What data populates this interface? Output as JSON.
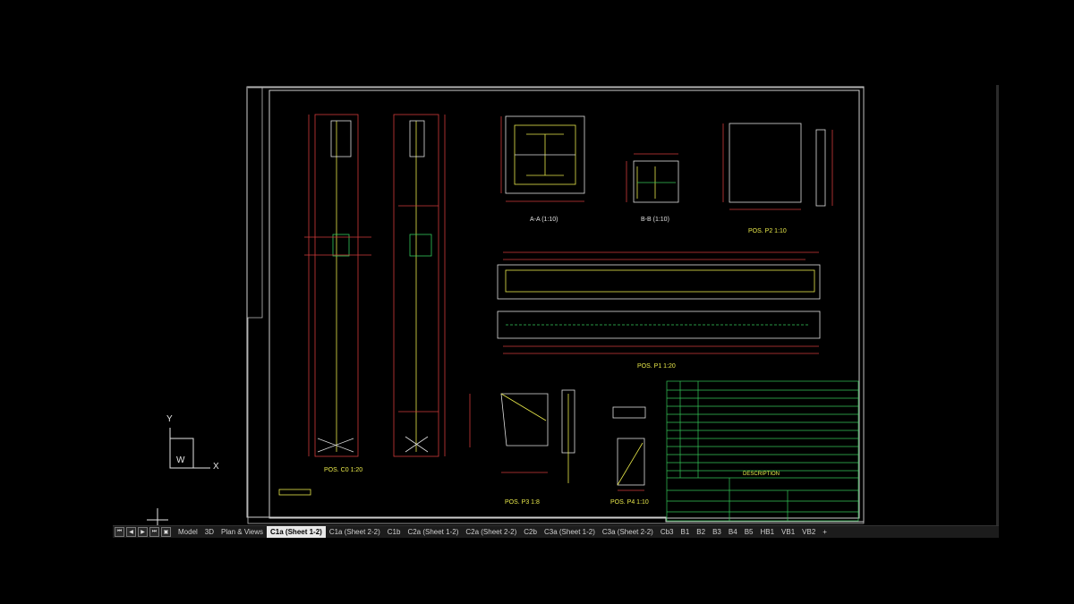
{
  "views": {
    "section_aa": "A-A (1:10)",
    "section_bb": "B-B (1:10)",
    "pos_p2": "POS. P2 1:10",
    "pos_p1": "POS. P1 1:20",
    "pos_p3": "POS. P3 1:8",
    "pos_p4": "POS. P4 1:10",
    "pos_c0": "POS. C0 1:20"
  },
  "ucs": {
    "x": "X",
    "y": "Y",
    "w": "W"
  },
  "tabs": [
    "Model",
    "3D",
    "Plan & Views",
    "C1a (Sheet 1-2)",
    "C1a (Sheet 2-2)",
    "C1b",
    "C2a (Sheet 1-2)",
    "C2a (Sheet 2-2)",
    "C2b",
    "C3a (Sheet 1-2)",
    "C3a (Sheet 2-2)",
    "Cb3",
    "B1",
    "B2",
    "B3",
    "B4",
    "B5",
    "HB1",
    "VB1",
    "VB2",
    "+"
  ],
  "active_tab": "C1a (Sheet 1-2)",
  "title_block": {
    "description": "DESCRIPTION"
  },
  "colors": {
    "line_yellow": "#e8e84a",
    "line_red": "#d03a3a",
    "line_green": "#34c759",
    "line_white": "#dedede",
    "background": "#000000"
  }
}
